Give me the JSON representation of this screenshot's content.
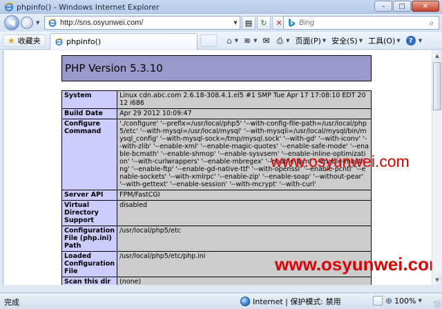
{
  "window": {
    "title": "phpinfo() - Windows Internet Explorer",
    "minimize_glyph": "–",
    "maximize_glyph": "□",
    "close_glyph": "✕"
  },
  "navbar": {
    "address": "http://sns.osyunwei.com/",
    "search_placeholder": "Bing",
    "back_glyph": "◀",
    "forward_glyph": "▶",
    "dropdown_glyph": "▼",
    "compat_glyph": "▤",
    "refresh_glyph": "↻",
    "stop_glyph": "✕",
    "search_glyph": "⌕"
  },
  "favbar": {
    "favorites_label": "收藏夹",
    "tab_title": "phpinfo()",
    "commands": [
      {
        "id": "home",
        "icon": "⌂"
      },
      {
        "id": "feeds",
        "icon": "≋"
      },
      {
        "id": "mail",
        "icon": "✉"
      },
      {
        "id": "print",
        "icon": "⎙"
      },
      {
        "id": "page",
        "icon": "",
        "label": "页面(P)"
      },
      {
        "id": "safety",
        "icon": "",
        "label": "安全(S)"
      },
      {
        "id": "tools",
        "icon": "",
        "label": "工具(O)"
      },
      {
        "id": "help",
        "icon": "?"
      }
    ]
  },
  "php": {
    "header": "PHP Version 5.3.10",
    "rows": [
      {
        "label": "System",
        "value": "Linux cdn.abc.com 2.6.18-308.4.1.el5 #1 SMP Tue Apr 17 17:08:10 EDT 2012 i686"
      },
      {
        "label": "Build Date",
        "value": "Apr 29 2012 10:09:47"
      },
      {
        "label": "Configure Command",
        "value": "'./configure' '--prefix=/usr/local/php5' '--with-config-file-path=/usr/local/php5/etc' '--with-mysql=/usr/local/mysql' '--with-mysqli=/usr/local/mysql/bin/mysql_config' '--with-mysql-sock=/tmp/mysql.sock' '--with-gd' '--with-iconv' '--with-zlib' '--enable-xml' '--enable-magic-quotes' '--enable-safe-mode' '--enable-bcmath' '--enable-shmop' '--enable-sysvsem' '--enable-inline-optimization' '--with-curlwrappers' '--enable-mbregex' '--enable-fpm' '--enable-mbstring' '--enable-ftp' '--enable-gd-native-ttf' '--with-openssl' '--enable-pcntl' '--enable-sockets' '--with-xmlrpc' '--enable-zip' '--enable-soap' '--without-pear' '--with-gettext' '--enable-session' '--with-mcrypt' '--with-curl'"
      },
      {
        "label": "Server API",
        "value": "FPM/FastCGI"
      },
      {
        "label": "Virtual Directory Support",
        "value": "disabled"
      },
      {
        "label": "Configuration File (php.ini) Path",
        "value": "/usr/local/php5/etc"
      },
      {
        "label": "Loaded Configuration File",
        "value": "/usr/local/php5/etc/php.ini"
      },
      {
        "label": "Scan this dir for",
        "value": "(none)"
      }
    ]
  },
  "watermark": {
    "text1": "www.osyunwei.com",
    "text2": "www.osyunwei.com"
  },
  "scrollbar": {
    "up_glyph": "▲",
    "down_glyph": "▼"
  },
  "statusbar": {
    "done": "完成",
    "zone": "Internet | 保护模式: 禁用",
    "zoom": "100%",
    "zoom_glyph": "⊕",
    "dropdown_glyph": "▼"
  },
  "colors": {
    "php_header_bg": "#9999cc",
    "php_label_bg": "#ccccff",
    "php_value_bg": "#cccccc",
    "watermark": "#e00000"
  }
}
